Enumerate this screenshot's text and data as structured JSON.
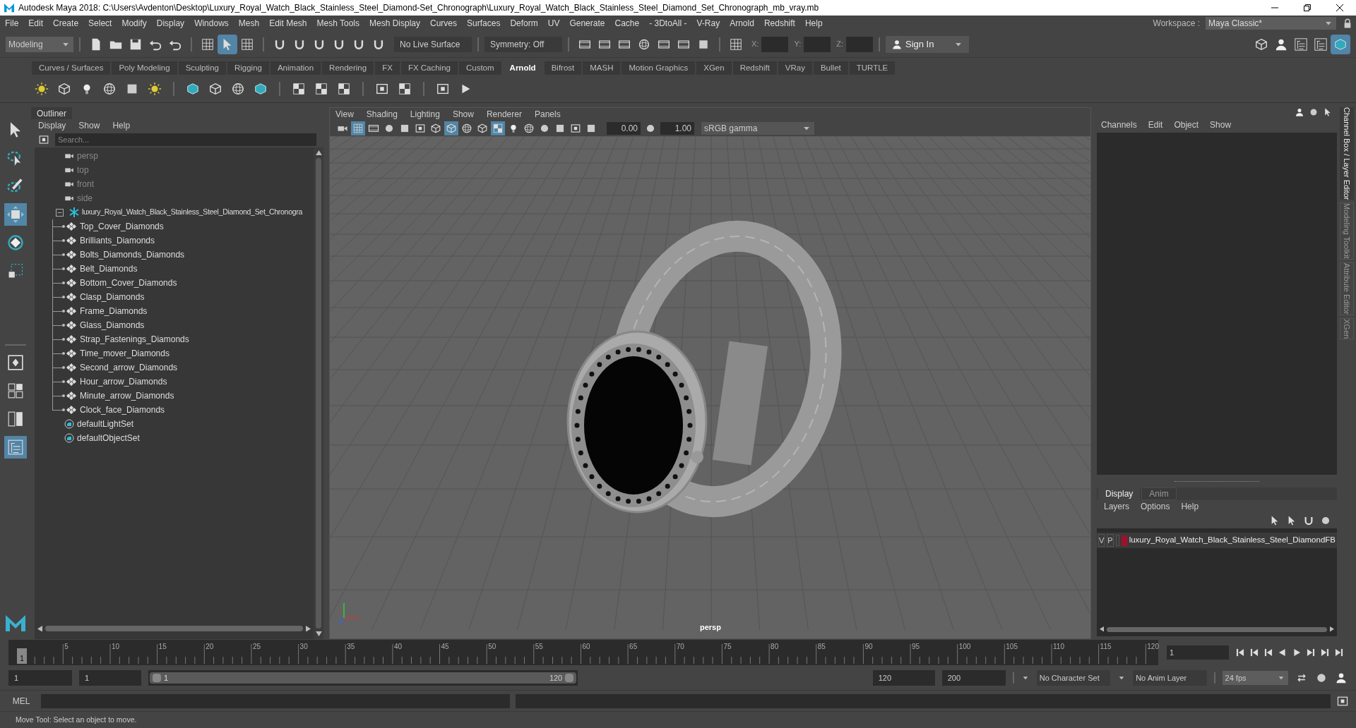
{
  "window": {
    "title": "Autodesk Maya 2018: C:\\Users\\Avdenton\\Desktop\\Luxury_Royal_Watch_Black_Stainless_Steel_Diamond-Set_Chronograph\\Luxury_Royal_Watch_Black_Stainless_Steel_Diamond_Set_Chronograph_mb_vray.mb"
  },
  "menu_bar": [
    "File",
    "Edit",
    "Create",
    "Select",
    "Modify",
    "Display",
    "Windows",
    "Mesh",
    "Edit Mesh",
    "Mesh Tools",
    "Mesh Display",
    "Curves",
    "Surfaces",
    "Deform",
    "UV",
    "Generate",
    "Cache",
    "- 3DtoAll -",
    "V-Ray",
    "Arnold",
    "Redshift",
    "Help"
  ],
  "workspace": {
    "label": "Workspace :",
    "value": "Maya Classic*"
  },
  "status_line": {
    "mode": "Modeling",
    "live_surface": "No Live Surface",
    "symmetry": "Symmetry: Off",
    "x_label": "X:",
    "y_label": "Y:",
    "z_label": "Z:",
    "sign_in": "Sign In"
  },
  "selection_modes": [
    {
      "selected": false
    },
    {
      "selected": true
    },
    {
      "selected": false
    }
  ],
  "panel_toggles": [
    {
      "selected": false
    },
    {
      "selected": false
    },
    {
      "selected": false
    },
    {
      "selected": false
    },
    {
      "selected": true
    }
  ],
  "shelf_tabs": [
    {
      "label": "Curves / Surfaces",
      "selected": false
    },
    {
      "label": "Poly Modeling",
      "selected": false
    },
    {
      "label": "Sculpting",
      "selected": false
    },
    {
      "label": "Rigging",
      "selected": false
    },
    {
      "label": "Animation",
      "selected": false
    },
    {
      "label": "Rendering",
      "selected": false
    },
    {
      "label": "FX",
      "selected": false
    },
    {
      "label": "FX Caching",
      "selected": false
    },
    {
      "label": "Custom",
      "selected": false
    },
    {
      "label": "Arnold",
      "selected": true
    },
    {
      "label": "Bifrost",
      "selected": false
    },
    {
      "label": "MASH",
      "selected": false
    },
    {
      "label": "Motion Graphics",
      "selected": false
    },
    {
      "label": "XGen",
      "selected": false
    },
    {
      "label": "Redshift",
      "selected": false
    },
    {
      "label": "VRay",
      "selected": false
    },
    {
      "label": "Bullet",
      "selected": false
    },
    {
      "label": "TURTLE",
      "selected": false
    }
  ],
  "tools": [
    {
      "kind": "select",
      "selected": false
    },
    {
      "kind": "lasso",
      "selected": false
    },
    {
      "kind": "paint",
      "selected": false
    },
    {
      "kind": "move",
      "selected": true
    },
    {
      "kind": "rotate",
      "selected": false
    },
    {
      "kind": "scale",
      "selected": false
    }
  ],
  "layouts": [
    {
      "kind": "single",
      "selected": false
    },
    {
      "kind": "four",
      "selected": false
    },
    {
      "kind": "two",
      "selected": false
    },
    {
      "kind": "outliner",
      "selected": true
    }
  ],
  "outliner": {
    "title": "Outliner",
    "menus": [
      "Display",
      "Show",
      "Help"
    ],
    "placeholder": "Search...",
    "items": [
      {
        "kind": "camera",
        "label": "persp"
      },
      {
        "kind": "camera",
        "label": "top"
      },
      {
        "kind": "camera",
        "label": "front"
      },
      {
        "kind": "camera",
        "label": "side"
      },
      {
        "kind": "group",
        "label": "luxury_Royal_Watch_Black_Stainless_Steel_Diamond_Set_Chronogra",
        "expanded": true,
        "children": [
          {
            "kind": "mesh",
            "label": "Top_Cover_Diamonds"
          },
          {
            "kind": "mesh",
            "label": "Brilliants_Diamonds"
          },
          {
            "kind": "mesh",
            "label": "Bolts_Diamonds_Diamonds"
          },
          {
            "kind": "mesh",
            "label": "Belt_Diamonds"
          },
          {
            "kind": "mesh",
            "label": "Bottom_Cover_Diamonds"
          },
          {
            "kind": "mesh",
            "label": "Clasp_Diamonds"
          },
          {
            "kind": "mesh",
            "label": "Frame_Diamonds"
          },
          {
            "kind": "mesh",
            "label": "Glass_Diamonds"
          },
          {
            "kind": "mesh",
            "label": "Strap_Fastenings_Diamonds"
          },
          {
            "kind": "mesh",
            "label": "Time_mover_Diamonds"
          },
          {
            "kind": "mesh",
            "label": "Second_arrow_Diamonds"
          },
          {
            "kind": "mesh",
            "label": "Hour_arrow_Diamonds"
          },
          {
            "kind": "mesh",
            "label": "Minute_arrow_Diamonds"
          },
          {
            "kind": "mesh",
            "label": "Clock_face_Diamonds"
          }
        ]
      },
      {
        "kind": "set",
        "label": "defaultLightSet"
      },
      {
        "kind": "set",
        "label": "defaultObjectSet"
      }
    ]
  },
  "viewport": {
    "menus": [
      "View",
      "Shading",
      "Lighting",
      "Show",
      "Renderer",
      "Panels"
    ],
    "exposure": "0.00",
    "gamma": "1.00",
    "color_space": "sRGB gamma",
    "camera_label": "persp",
    "tools": [
      {
        "kind": "camera",
        "on": false
      },
      {
        "kind": "grid",
        "on": true
      },
      {
        "kind": "film",
        "on": false
      },
      {
        "kind": "circle",
        "on": false
      },
      {
        "kind": "square",
        "on": false
      },
      {
        "kind": "frame",
        "on": false
      },
      {
        "kind": "cube",
        "on": false
      },
      {
        "kind": "cube",
        "on": true
      },
      {
        "kind": "sphere",
        "on": false
      },
      {
        "kind": "cube",
        "on": false
      },
      {
        "kind": "checker",
        "on": true
      },
      {
        "kind": "light",
        "on": false
      },
      {
        "kind": "sphere",
        "on": false
      },
      {
        "kind": "circle",
        "on": false
      },
      {
        "kind": "square",
        "on": false
      },
      {
        "kind": "frame",
        "on": false
      },
      {
        "kind": "square",
        "on": false
      }
    ]
  },
  "channel_box": {
    "menus": [
      "Channels",
      "Edit",
      "Object",
      "Show"
    ]
  },
  "layer_editor": {
    "tabs": [
      {
        "label": "Display",
        "selected": true
      },
      {
        "label": "Anim",
        "selected": false
      }
    ],
    "menus": [
      "Layers",
      "Options",
      "Help"
    ],
    "layers": [
      {
        "visible": "V",
        "playback": "P",
        "color": "#a0102a",
        "name": "luxury_Royal_Watch_Black_Stainless_Steel_DiamondFB"
      }
    ]
  },
  "side_tabs": [
    {
      "label": "Channel Box / Layer Editor",
      "selected": true
    },
    {
      "label": "Modeling Toolkit",
      "selected": false
    },
    {
      "label": "Attribute Editor",
      "selected": false
    },
    {
      "label": "XGen",
      "selected": false
    }
  ],
  "timeline": {
    "ticks": [
      "5",
      "10",
      "15",
      "20",
      "25",
      "30",
      "35",
      "40",
      "45",
      "50",
      "55",
      "60",
      "65",
      "70",
      "75",
      "80",
      "85",
      "90",
      "95",
      "100",
      "105",
      "110",
      "115",
      "120"
    ],
    "current_frame": "1",
    "frame_field": "1"
  },
  "range": {
    "level": 1,
    "start": "1",
    "playback_start": "1",
    "slider_start": "1",
    "slider_end": "120",
    "playback_end": "120",
    "end": "200",
    "character_set": "No Character Set",
    "anim_layer": "No Anim Layer",
    "fps": "24 fps"
  },
  "command_line": {
    "label": "MEL"
  },
  "status_bar": "Move Tool: Select an object to move."
}
